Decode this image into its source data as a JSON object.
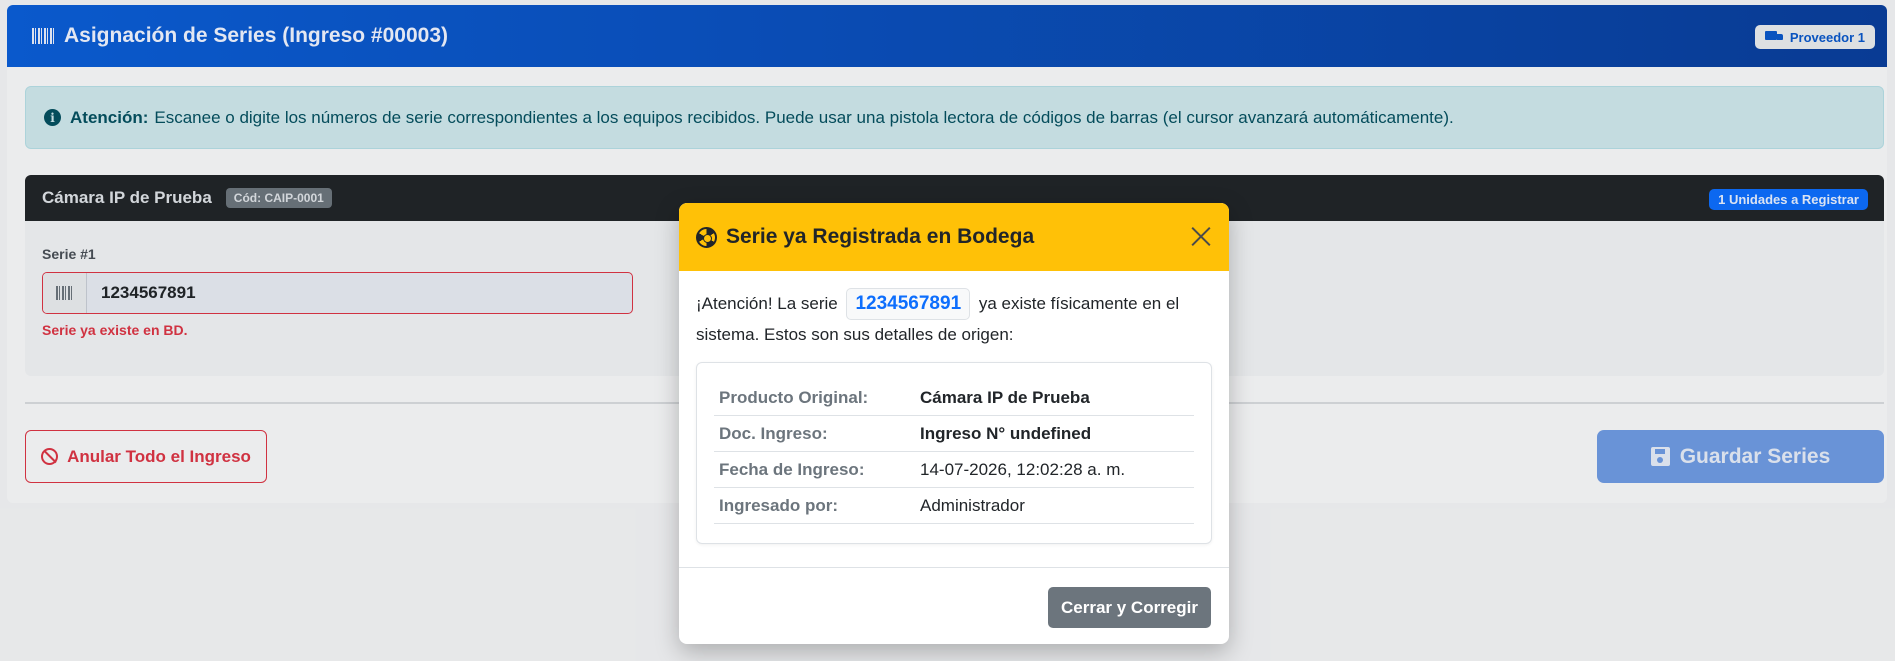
{
  "header": {
    "title": "Asignación de Series (Ingreso #00003)",
    "provider_badge": "Proveedor 1"
  },
  "alert": {
    "strong": "Atención:",
    "text": "Escanee o digite los números de serie correspondientes a los equipos recibidos. Puede usar una pistola lectora de códigos de barras (el cursor avanzará automáticamente)."
  },
  "product": {
    "name": "Cámara IP de Prueba",
    "code": "Cód: CAIP-0001",
    "units_badge": "1 Unidades a Registrar",
    "serie_label": "Serie #1",
    "serie_value": "1234567891",
    "error": "Serie ya existe en BD."
  },
  "actions": {
    "anular_label": "Anular Todo el Ingreso",
    "guardar_label": "Guardar Series"
  },
  "modal": {
    "title": "Serie ya Registrada en Bodega",
    "msg_pre": "¡Atención! La serie",
    "serie": "1234567891",
    "msg_post": "ya existe físicamente en el sistema. Estos son sus detalles de origen:",
    "details": [
      {
        "key": "Producto Original:",
        "value": "Cámara IP de Prueba"
      },
      {
        "key": "Doc. Ingreso:",
        "value": "Ingreso N° undefined"
      },
      {
        "key": "Fecha de Ingreso:",
        "value": "14-07-2026, 12:02:28 a. m."
      },
      {
        "key": "Ingresado por:",
        "value": "Administrador"
      }
    ],
    "close_label": "Cerrar y Corregir"
  },
  "colors": {
    "primary": "#0d6efd",
    "warning": "#ffc107",
    "danger": "#dc3545",
    "secondary": "#6c757d",
    "info_bg": "#cfe8ed"
  }
}
